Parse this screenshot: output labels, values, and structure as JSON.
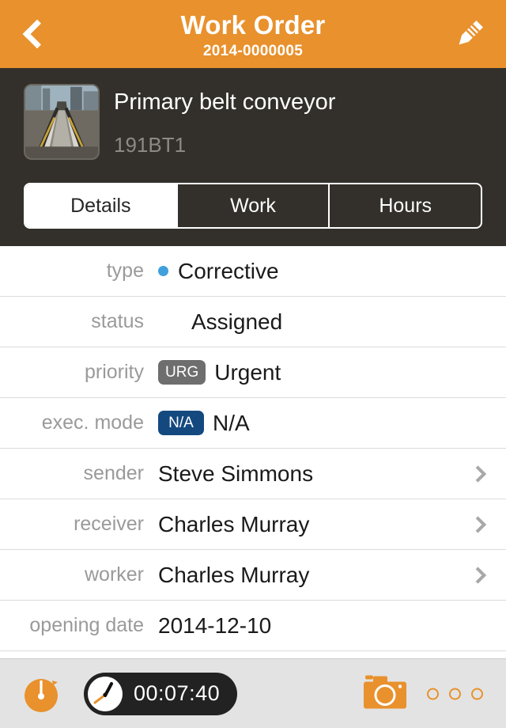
{
  "header": {
    "title": "Work Order",
    "subtitle": "2014-0000005",
    "back_icon": "chevron-left-icon",
    "edit_icon": "pencil-icon"
  },
  "asset": {
    "title": "Primary belt conveyor",
    "code": "191BT1",
    "thumbnail_alt": "belt-conveyor-photo"
  },
  "tabs": [
    {
      "label": "Details",
      "active": true
    },
    {
      "label": "Work",
      "active": false
    },
    {
      "label": "Hours",
      "active": false
    }
  ],
  "details": [
    {
      "label": "type",
      "value": "Corrective",
      "marker": "dot",
      "chevron": false
    },
    {
      "label": "status",
      "value": "Assigned",
      "marker": "none",
      "chevron": false,
      "indent": true
    },
    {
      "label": "priority",
      "value": "Urgent",
      "marker": "badge",
      "badge_text": "URG",
      "badge_style": "gray",
      "chevron": false
    },
    {
      "label": "exec. mode",
      "value": "N/A",
      "marker": "badge",
      "badge_text": "N/A",
      "badge_style": "navy",
      "chevron": false
    },
    {
      "label": "sender",
      "value": "Steve Simmons",
      "marker": "none",
      "chevron": true
    },
    {
      "label": "receiver",
      "value": "Charles Murray",
      "marker": "none",
      "chevron": true
    },
    {
      "label": "worker",
      "value": "Charles Murray",
      "marker": "none",
      "chevron": true
    },
    {
      "label": "opening date",
      "value": "2014-12-10",
      "marker": "none",
      "chevron": false
    }
  ],
  "toolbar": {
    "stopwatch_icon": "stopwatch-icon",
    "timer_value": "00:07:40",
    "timer_clock_icon": "clock-face-icon",
    "camera_icon": "camera-icon",
    "more_icon": "more-dots-icon",
    "more_dots": 3
  },
  "colors": {
    "accent_orange": "#e8912d",
    "dark_panel": "#33302b",
    "type_dot_blue": "#3fa0dc",
    "badge_gray": "#6e6e6e",
    "badge_navy": "#14497f",
    "toolbar_bg": "#e3e3e3"
  }
}
